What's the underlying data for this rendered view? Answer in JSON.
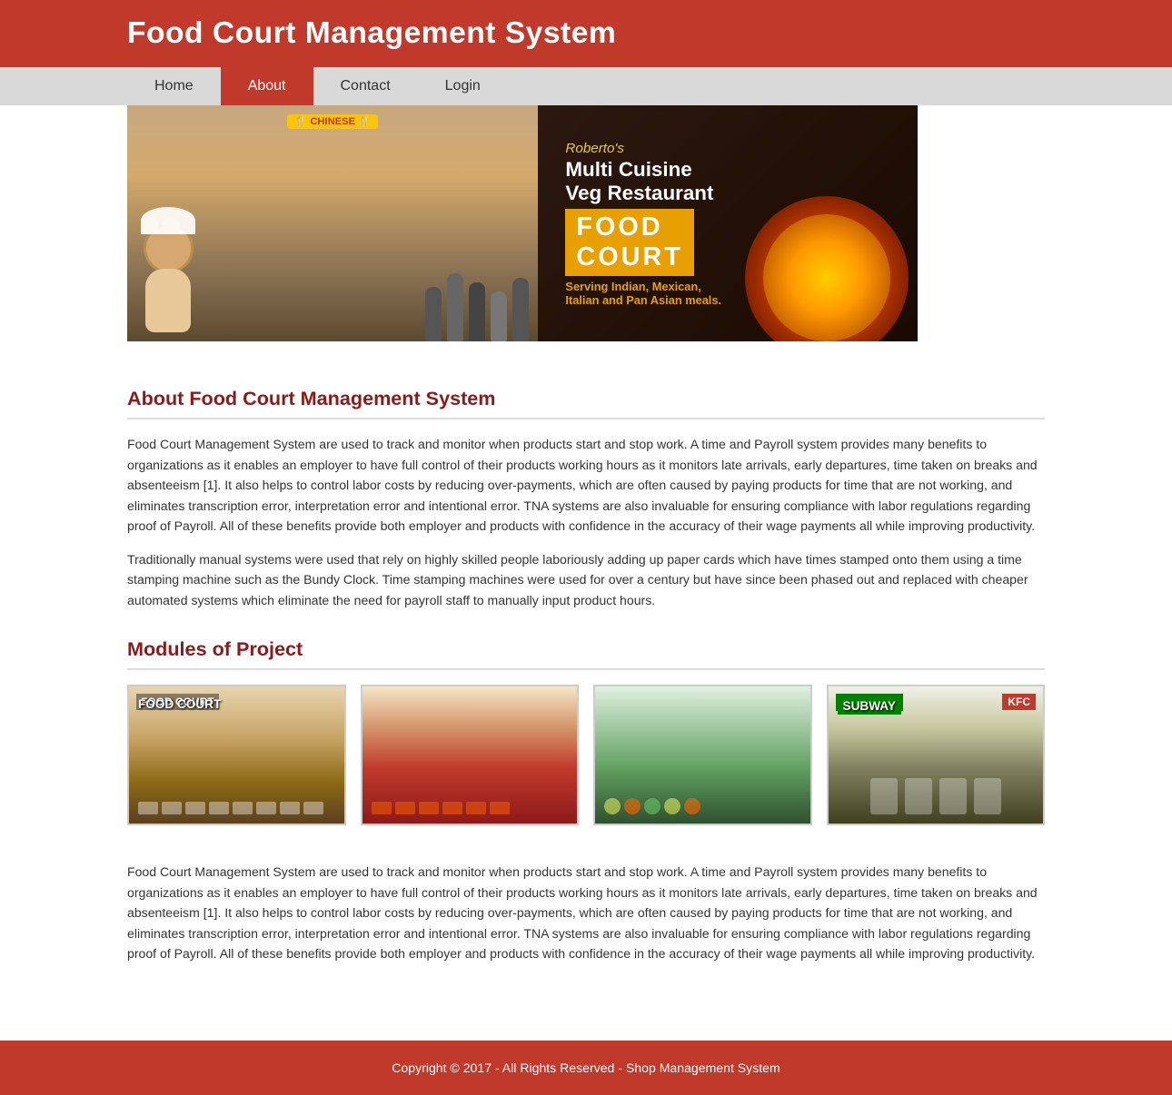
{
  "header": {
    "title": "Food Court Management System",
    "background": "#c0392b"
  },
  "nav": {
    "items": [
      {
        "label": "Home",
        "active": false
      },
      {
        "label": "About",
        "active": true
      },
      {
        "label": "Contact",
        "active": false
      },
      {
        "label": "Login",
        "active": false
      }
    ]
  },
  "hero": {
    "line1": "Multi Cuisine",
    "line2": "Veg Restaurant",
    "badge": "FOOD\nCOURT",
    "brand": "Roberto's",
    "serving": "Serving Indian, Mexican,\nItalian and Pan Asian meals."
  },
  "about": {
    "section_title": "About Food Court Management System",
    "paragraph1": "Food Court Management System are used to track and monitor when products start and stop work. A time and Payroll system provides many benefits to organizations as it enables an employer to have full control of their products working hours as it monitors late arrivals, early departures, time taken on breaks and absenteeism [1]. It also helps to control labor costs by reducing over-payments, which are often caused by paying products for time that are not working, and eliminates transcription error, interpretation error and intentional error. TNA systems are also invaluable for ensuring compliance with labor regulations regarding proof of Payroll. All of these benefits provide both employer and products with confidence in the accuracy of their wage payments all while improving productivity.",
    "paragraph2": "Traditionally manual systems were used that rely on highly skilled people laboriously adding up paper cards which have times stamped onto them using a time stamping machine such as the Bundy Clock. Time stamping machines were used for over a century but have since been phased out and replaced with cheaper automated systems which eliminate the need for payroll staff to manually input product hours."
  },
  "modules": {
    "section_title": "Modules of Project",
    "images": [
      {
        "alt": "Food Court 1"
      },
      {
        "alt": "Food Court 2"
      },
      {
        "alt": "Food Court 3"
      },
      {
        "alt": "Subway Restaurant"
      }
    ]
  },
  "bottom_paragraph": "Food Court Management System are used to track and monitor when products start and stop work. A time and Payroll system provides many benefits to organizations as it enables an employer to have full control of their products working hours as it monitors late arrivals, early departures, time taken on breaks and absenteeism [1]. It also helps to control labor costs by reducing over-payments, which are often caused by paying products for time that are not working, and eliminates transcription error, interpretation error and intentional error. TNA systems are also invaluable for ensuring compliance with labor regulations regarding proof of Payroll. All of these benefits provide both employer and products with confidence in the accuracy of their wage payments all while improving productivity.",
  "footer": {
    "text": "Copyright © 2017 - All Rights Reserved - Shop Management System"
  }
}
